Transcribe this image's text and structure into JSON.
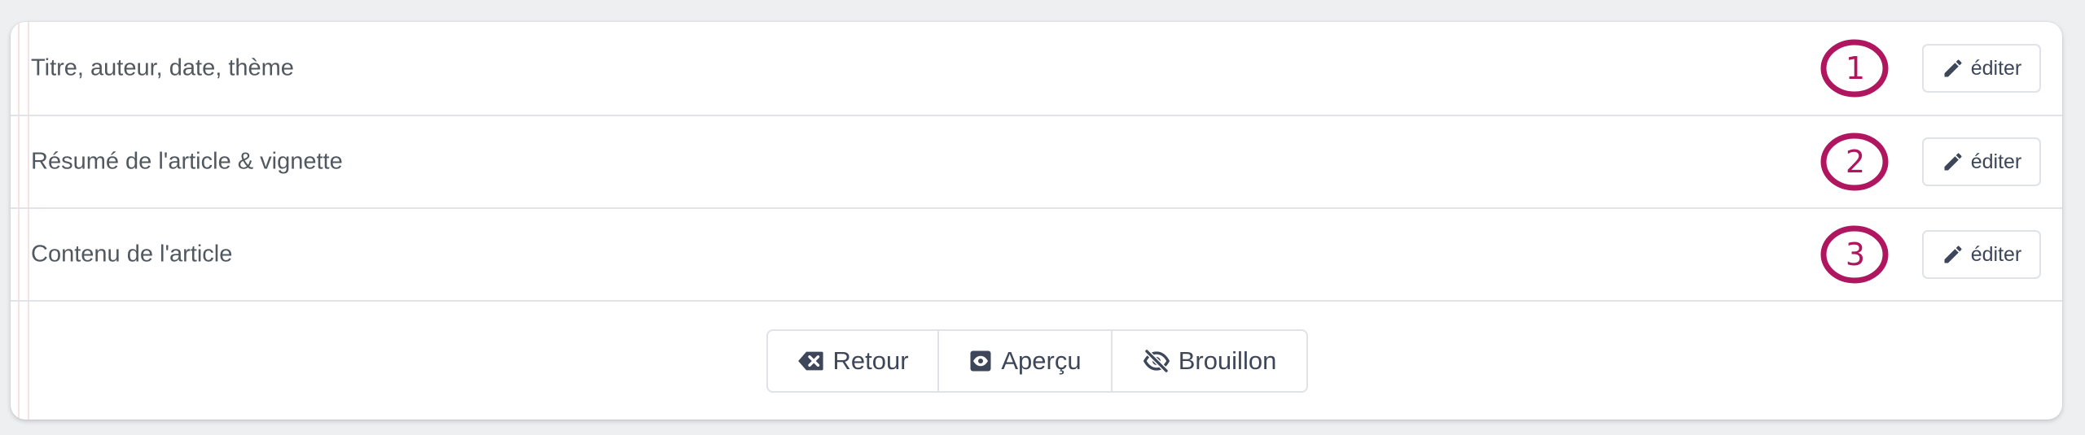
{
  "sections": [
    {
      "label": "Titre, auteur, date, thème",
      "step": "1",
      "edit_label": "éditer"
    },
    {
      "label": "Résumé de l'article & vignette",
      "step": "2",
      "edit_label": "éditer"
    },
    {
      "label": "Contenu de l'article",
      "step": "3",
      "edit_label": "éditer"
    }
  ],
  "footer": {
    "back_label": "Retour",
    "preview_label": "Aperçu",
    "draft_label": "Brouillon"
  },
  "colors": {
    "accent": "#b0155f",
    "icon": "#3e475a"
  },
  "icons": {
    "edit": "pencil-icon",
    "back": "backspace-icon",
    "preview": "eye-icon",
    "draft": "eye-slash-icon"
  }
}
